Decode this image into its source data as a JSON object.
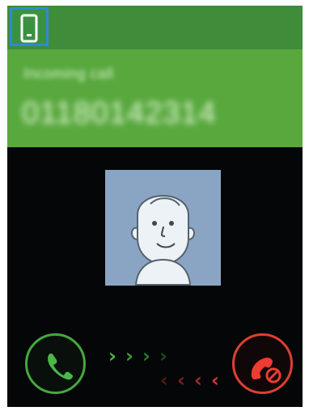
{
  "status_bar": {
    "device_icon": "smartphone-icon",
    "background": "#3f8d3a",
    "badge_border": "#2f8ad0"
  },
  "caller": {
    "label": "Incoming call",
    "number": "01180142314",
    "panel_color": "#58a83e",
    "avatar_icon": "default-contact-icon"
  },
  "actions": {
    "accept_icon": "phone-accept-icon",
    "reject_icon": "phone-reject-icon",
    "accept_color": "#45a83f",
    "reject_color": "#df3f33",
    "right_chevrons": [
      "›",
      "›",
      "›",
      "›"
    ],
    "left_chevrons": [
      "‹",
      "‹",
      "‹",
      "‹"
    ]
  }
}
